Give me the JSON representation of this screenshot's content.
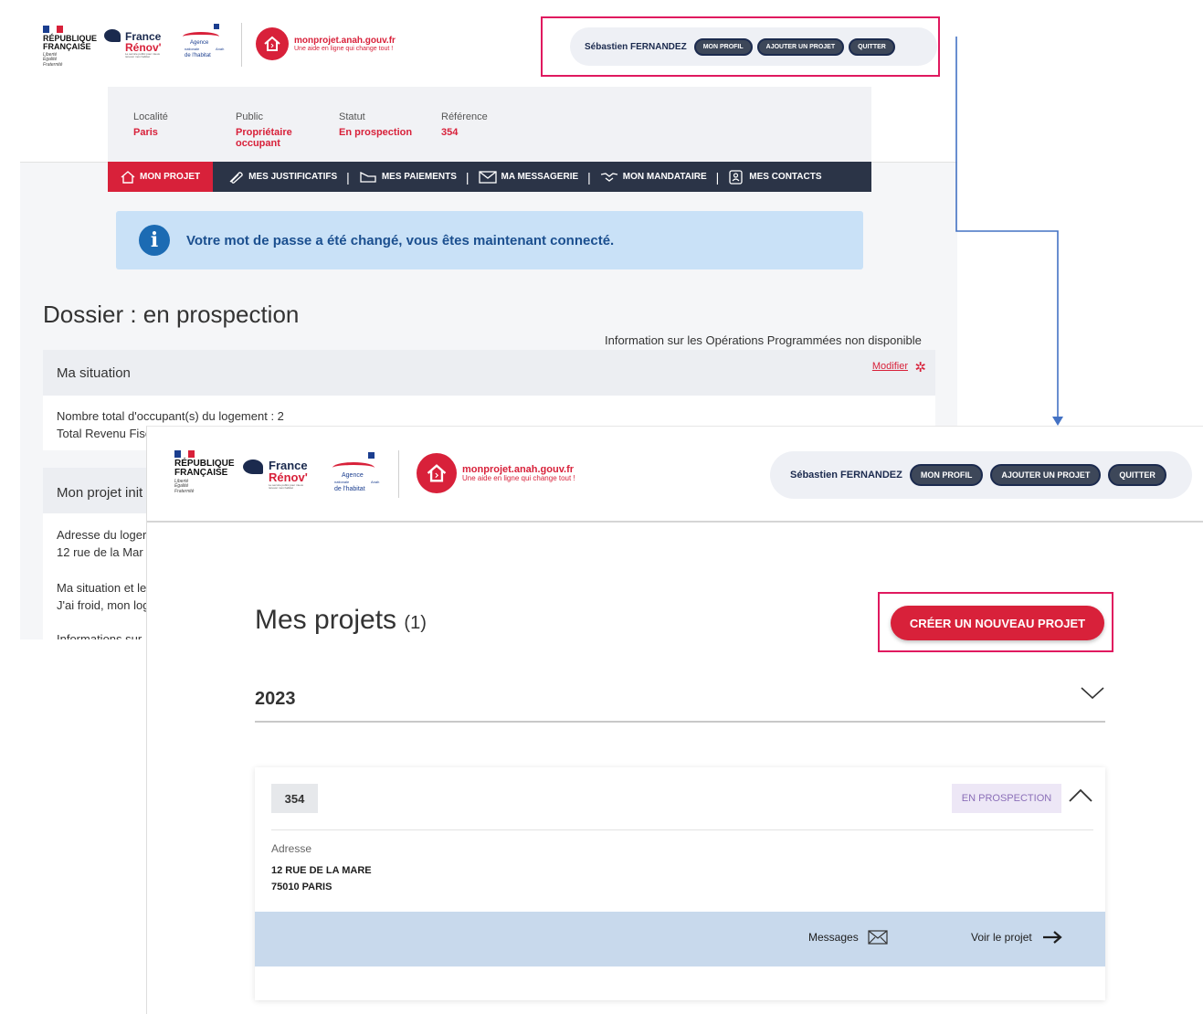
{
  "logos": {
    "rf_name_1": "RÉPUBLIQUE",
    "rf_name_2": "FRANÇAISE",
    "rf_devise_1": "Liberté",
    "rf_devise_2": "Égalité",
    "rf_devise_3": "Fraternité",
    "france_renov_1": "France",
    "france_renov_2": "Rénov'",
    "france_renov_tag": "Le service public pour mieux rénover mon habitat",
    "anah_1": "Agence",
    "anah_2": "nationale",
    "anah_3": "de l'habitat",
    "anah_short": "Anah",
    "site_name": "monprojet.anah.gouv.fr",
    "site_tagline": "Une aide en ligne qui change tout !"
  },
  "user": {
    "name": "Sébastien FERNANDEZ",
    "profile_btn": "MON PROFIL",
    "add_project_btn": "AJOUTER UN PROJET",
    "quit_btn": "QUITTER"
  },
  "back_page": {
    "info": {
      "localite_label": "Localité",
      "localite_value": "Paris",
      "public_label": "Public",
      "public_value_1": "Propriétaire",
      "public_value_2": "occupant",
      "statut_label": "Statut",
      "statut_value": "En prospection",
      "reference_label": "Référence",
      "reference_value": "354"
    },
    "tabs": [
      {
        "label": "MON PROJET"
      },
      {
        "label": "MES JUSTIFICATIFS"
      },
      {
        "label": "MES PAIEMENTS"
      },
      {
        "label": "MA MESSAGERIE"
      },
      {
        "label": "MON MANDATAIRE"
      },
      {
        "label": "MES CONTACTS"
      }
    ],
    "alert_text": "Votre mot de passe a été changé, vous êtes maintenant connecté.",
    "dossier_title": "Dossier : en prospection",
    "op_info": "Information sur les Opérations Programmées non disponible",
    "situation": {
      "title": "Ma situation",
      "modify": "Modifier",
      "line1": "Nombre total d'occupant(s) du logement : 2",
      "line2": "Total Revenu Fisc"
    },
    "project": {
      "title": "Mon projet init",
      "line1": "Adresse du loger",
      "line2": "12 rue de la Mar",
      "line3": "Ma situation et le",
      "line4": "J'ai froid, mon log",
      "line5": "Informations sur"
    }
  },
  "front_page": {
    "title": "Mes projets",
    "count": "(1)",
    "create_btn": "CRÉER UN NOUVEAU PROJET",
    "year": "2023",
    "card": {
      "reference": "354",
      "status": "EN PROSPECTION",
      "address_label": "Adresse",
      "address_line1": "12 RUE DE LA MARE",
      "address_line2": "75010 PARIS",
      "messages_link": "Messages",
      "view_link": "Voir le projet"
    }
  },
  "colors": {
    "brand_red": "#d8213a",
    "navy": "#1b2a4e",
    "highlight": "#e0195f",
    "connector": "#4472c4",
    "alert_bg": "#c9e1f7",
    "status_bg": "#ede7f6",
    "card_footer": "#c8d9ec"
  },
  "icons": {
    "info": "i",
    "gear": "✲"
  }
}
